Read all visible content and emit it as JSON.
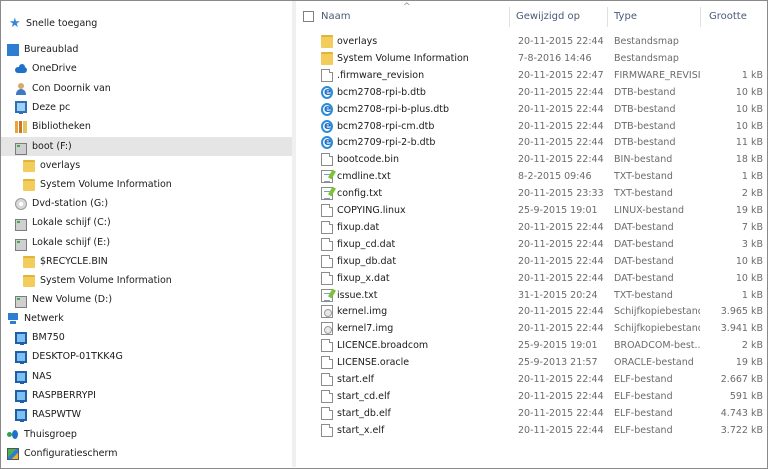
{
  "nav": {
    "items": [
      {
        "label": "Snelle toegang",
        "icon": "star-icon"
      },
      {
        "label": "Bureaublad",
        "icon": "desktop-icon"
      },
      {
        "label": "OneDrive",
        "icon": "cloud-icon"
      },
      {
        "label": "Con Doornik van",
        "icon": "user-icon"
      },
      {
        "label": "Deze pc",
        "icon": "pc-icon"
      },
      {
        "label": "Bibliotheken",
        "icon": "library-icon"
      },
      {
        "label": "boot (F:)",
        "icon": "drive-icon"
      },
      {
        "label": "overlays",
        "icon": "folder-icon"
      },
      {
        "label": "System Volume Information",
        "icon": "folder-icon"
      },
      {
        "label": "Dvd-station (G:)",
        "icon": "dvd-icon"
      },
      {
        "label": "Lokale schijf (C:)",
        "icon": "drive-icon"
      },
      {
        "label": "Lokale schijf (E:)",
        "icon": "drive-icon"
      },
      {
        "label": "$RECYCLE.BIN",
        "icon": "folder-icon"
      },
      {
        "label": "System Volume Information",
        "icon": "folder-icon"
      },
      {
        "label": "New Volume (D:)",
        "icon": "drive-icon"
      },
      {
        "label": "Netwerk",
        "icon": "network-icon"
      },
      {
        "label": "BM750",
        "icon": "computer-icon"
      },
      {
        "label": "DESKTOP-01TKK4G",
        "icon": "computer-icon"
      },
      {
        "label": "NAS",
        "icon": "computer-icon"
      },
      {
        "label": "RASPBERRYPI",
        "icon": "computer-icon"
      },
      {
        "label": "RASPWTW",
        "icon": "computer-icon"
      },
      {
        "label": "Thuisgroep",
        "icon": "homegroup-icon"
      },
      {
        "label": "Configuratiescherm",
        "icon": "control-panel-icon"
      }
    ],
    "selected_index": 6
  },
  "columns": {
    "name": "Naam",
    "modified": "Gewijzigd op",
    "type": "Type",
    "size": "Grootte"
  },
  "files": [
    {
      "name": "overlays",
      "date": "20-11-2015 22:44",
      "type": "Bestandsmap",
      "size": "",
      "icon": "folder-icon"
    },
    {
      "name": "System Volume Information",
      "date": "7-8-2016 14:46",
      "type": "Bestandsmap",
      "size": "",
      "icon": "folder-icon"
    },
    {
      "name": ".firmware_revision",
      "date": "20-11-2015 22:47",
      "type": "FIRMWARE_REVISI...",
      "size": "1 kB",
      "icon": "file-icon"
    },
    {
      "name": "bcm2708-rpi-b.dtb",
      "date": "20-11-2015 22:44",
      "type": "DTB-bestand",
      "size": "10 kB",
      "icon": "ie-icon"
    },
    {
      "name": "bcm2708-rpi-b-plus.dtb",
      "date": "20-11-2015 22:44",
      "type": "DTB-bestand",
      "size": "10 kB",
      "icon": "ie-icon"
    },
    {
      "name": "bcm2708-rpi-cm.dtb",
      "date": "20-11-2015 22:44",
      "type": "DTB-bestand",
      "size": "10 kB",
      "icon": "ie-icon"
    },
    {
      "name": "bcm2709-rpi-2-b.dtb",
      "date": "20-11-2015 22:44",
      "type": "DTB-bestand",
      "size": "11 kB",
      "icon": "ie-icon"
    },
    {
      "name": "bootcode.bin",
      "date": "20-11-2015 22:44",
      "type": "BIN-bestand",
      "size": "18 kB",
      "icon": "file-icon"
    },
    {
      "name": "cmdline.txt",
      "date": "8-2-2015 09:46",
      "type": "TXT-bestand",
      "size": "1 kB",
      "icon": "txt-icon"
    },
    {
      "name": "config.txt",
      "date": "20-11-2015 23:33",
      "type": "TXT-bestand",
      "size": "2 kB",
      "icon": "txt-icon"
    },
    {
      "name": "COPYING.linux",
      "date": "25-9-2015 19:01",
      "type": "LINUX-bestand",
      "size": "19 kB",
      "icon": "file-icon"
    },
    {
      "name": "fixup.dat",
      "date": "20-11-2015 22:44",
      "type": "DAT-bestand",
      "size": "7 kB",
      "icon": "file-icon"
    },
    {
      "name": "fixup_cd.dat",
      "date": "20-11-2015 22:44",
      "type": "DAT-bestand",
      "size": "3 kB",
      "icon": "file-icon"
    },
    {
      "name": "fixup_db.dat",
      "date": "20-11-2015 22:44",
      "type": "DAT-bestand",
      "size": "10 kB",
      "icon": "file-icon"
    },
    {
      "name": "fixup_x.dat",
      "date": "20-11-2015 22:44",
      "type": "DAT-bestand",
      "size": "10 kB",
      "icon": "file-icon"
    },
    {
      "name": "issue.txt",
      "date": "31-1-2015 20:24",
      "type": "TXT-bestand",
      "size": "1 kB",
      "icon": "txt-icon"
    },
    {
      "name": "kernel.img",
      "date": "20-11-2015 22:44",
      "type": "Schijfkopiebestand",
      "size": "3.965 kB",
      "icon": "disk-image-icon"
    },
    {
      "name": "kernel7.img",
      "date": "20-11-2015 22:44",
      "type": "Schijfkopiebestand",
      "size": "3.941 kB",
      "icon": "disk-image-icon"
    },
    {
      "name": "LICENCE.broadcom",
      "date": "25-9-2015 19:01",
      "type": "BROADCOM-best...",
      "size": "2 kB",
      "icon": "file-icon"
    },
    {
      "name": "LICENSE.oracle",
      "date": "25-9-2013 21:57",
      "type": "ORACLE-bestand",
      "size": "19 kB",
      "icon": "file-icon"
    },
    {
      "name": "start.elf",
      "date": "20-11-2015 22:44",
      "type": "ELF-bestand",
      "size": "2.667 kB",
      "icon": "file-icon"
    },
    {
      "name": "start_cd.elf",
      "date": "20-11-2015 22:44",
      "type": "ELF-bestand",
      "size": "591 kB",
      "icon": "file-icon"
    },
    {
      "name": "start_db.elf",
      "date": "20-11-2015 22:44",
      "type": "ELF-bestand",
      "size": "4.743 kB",
      "icon": "file-icon"
    },
    {
      "name": "start_x.elf",
      "date": "20-11-2015 22:44",
      "type": "ELF-bestand",
      "size": "3.722 kB",
      "icon": "file-icon"
    }
  ]
}
